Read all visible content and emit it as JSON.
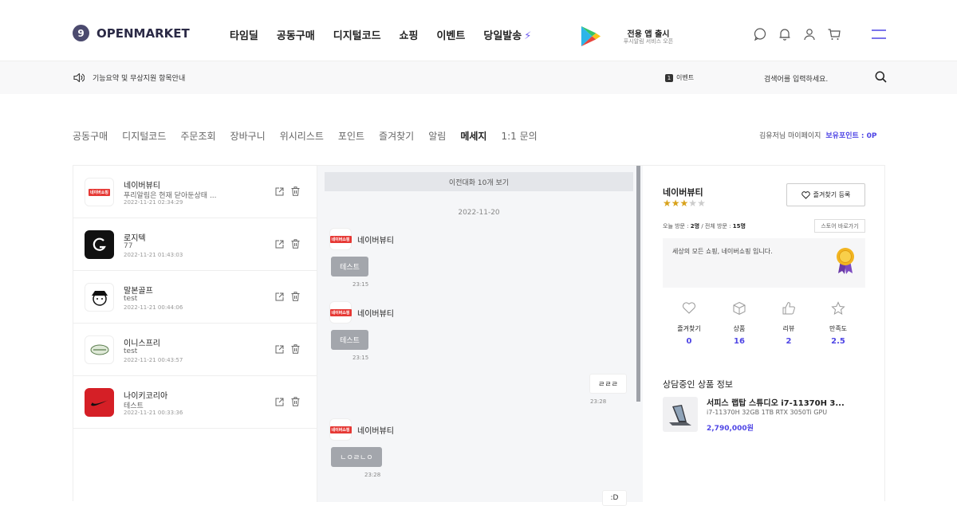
{
  "header": {
    "logo_mark": "9",
    "logo_text": "OPENMARKET",
    "nav": [
      "타임딜",
      "공동구매",
      "디지털코드",
      "쇼핑",
      "이벤트",
      "당일발송"
    ],
    "app_title": "전용 앱 출시",
    "app_sub": "푸시알림 서비스 오픈"
  },
  "subbar": {
    "notice": "기능요약 및 무상지원 항목안내",
    "event_count": "1",
    "event_label": "이벤트",
    "search_placeholder": "검색어를 입력하세요."
  },
  "tabs": [
    "공동구매",
    "디지털코드",
    "주문조회",
    "장바구니",
    "위시리스트",
    "포인트",
    "즐겨찾기",
    "알림",
    "메세지",
    "1:1 문의"
  ],
  "active_tab": "메세지",
  "mypage": {
    "label": "김유저님 마이페이지",
    "points": "보유포인트 : 0P"
  },
  "conversations": [
    {
      "name": "네이버뷰티",
      "message": "푸리알림은 현재 닫아둔상태 ...",
      "time": "2022-11-21 02:34:29",
      "icon": "naver-shopping-logo"
    },
    {
      "name": "로지텍",
      "message": "77",
      "time": "2022-11-21 01:43:03",
      "icon": "logitech-logo"
    },
    {
      "name": "말본골프",
      "message": "test",
      "time": "2022-11-21 00:44:06",
      "icon": "malbon-golf-logo"
    },
    {
      "name": "이니스프리",
      "message": "test",
      "time": "2022-11-21 00:43:57",
      "icon": "innisfree-logo"
    },
    {
      "name": "나이키코리아",
      "message": "테스트",
      "time": "2022-11-21 00:33:36",
      "icon": "nike-logo"
    }
  ],
  "chat": {
    "prev_label": "이전대화 10개 보기",
    "date": "2022-11-20",
    "logo_label": "네이버쇼핑",
    "sender": "네이버뷰티",
    "messages": [
      {
        "dir": "in",
        "text": "테스트",
        "time": "23:15"
      },
      {
        "dir": "in",
        "text": "테스트",
        "time": "23:15"
      },
      {
        "dir": "out",
        "text": "ㄹㄹㄹ",
        "time": "23:28"
      },
      {
        "dir": "in",
        "text": "ㄴㅇㄹㄴㅇ",
        "time": "23:28"
      },
      {
        "dir": "out",
        "text": ":D",
        "time": ""
      }
    ]
  },
  "store": {
    "name": "네이버뷰티",
    "rating": 3,
    "rating_max": 5,
    "fav_button": "즐겨찾기 등록",
    "visits_today_label": "오늘 방문 : ",
    "visits_today": "2명",
    "visits_total_label": " / 전체 방문 : ",
    "visits_total": "15명",
    "store_link": "스토어 바로가기",
    "intro": "세상의 모든 쇼핑, 네이버쇼핑 입니다.",
    "stats": [
      {
        "label": "즐겨찾기",
        "value": "0",
        "icon": "heart-icon"
      },
      {
        "label": "상품",
        "value": "16",
        "icon": "box-icon"
      },
      {
        "label": "리뷰",
        "value": "2",
        "icon": "thumbs-up-icon"
      },
      {
        "label": "만족도",
        "value": "2.5",
        "icon": "star-icon"
      }
    ],
    "product_section": "상담중인 상품 정보",
    "product": {
      "name": "서피스 랩탑 스튜디오 i7-11370H 3...",
      "spec": "i7-11370H 32GB 1TB RTX 3050Ti GPU",
      "price": "2,790,000원"
    }
  },
  "colors": {
    "accent": "#4f46e5",
    "bolt": "#6e5cf0",
    "bubble_in": "#a3a6ac",
    "chat_bg": "#f5f6f8"
  }
}
